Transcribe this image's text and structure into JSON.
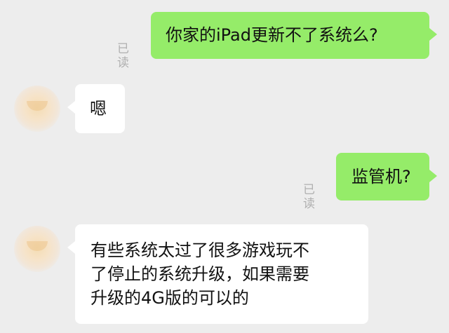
{
  "messages": [
    {
      "side": "out",
      "status": "已读",
      "lines": [
        "你家的iPad更新不了系统么?"
      ]
    },
    {
      "side": "in",
      "lines": [
        "嗯"
      ]
    },
    {
      "side": "out",
      "status": "已读",
      "lines": [
        "监管机?"
      ]
    },
    {
      "side": "in",
      "lines": [
        "有些系统太过了很多游戏玩不",
        "了停止的系统升级，如果需要",
        "升级的4G版的可以的"
      ]
    }
  ],
  "colors": {
    "background": "#ededed",
    "outgoing_bubble": "#95ec69",
    "incoming_bubble": "#ffffff",
    "read_status": "#b0b0b0"
  }
}
